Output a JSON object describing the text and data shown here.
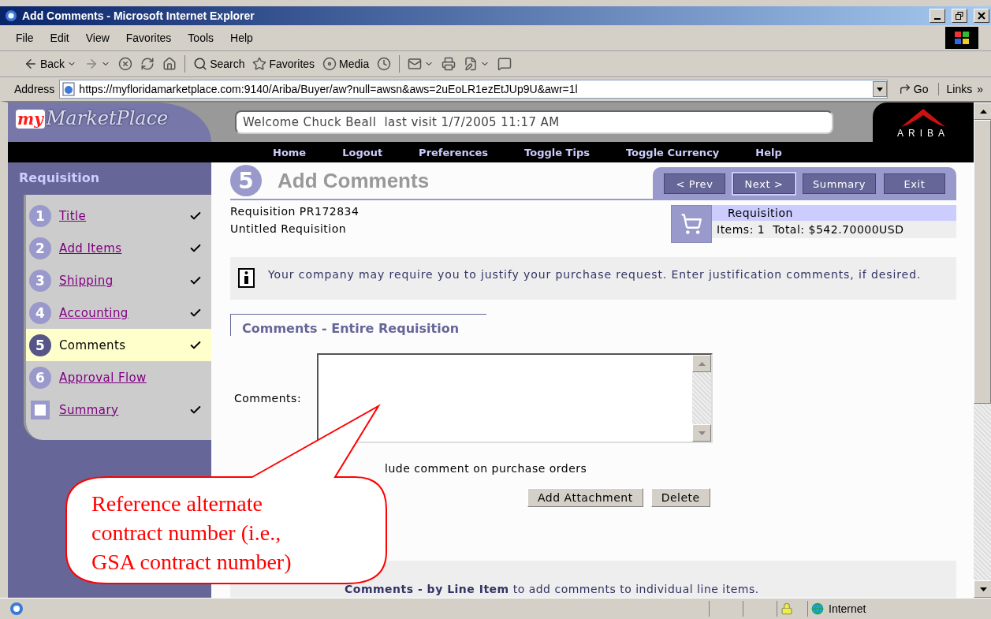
{
  "window": {
    "title": "Add Comments - Microsoft Internet Explorer"
  },
  "menu": [
    "File",
    "Edit",
    "View",
    "Favorites",
    "Tools",
    "Help"
  ],
  "toolbar": [
    {
      "items": [
        {
          "kind": "back",
          "label": "Back",
          "menu": true
        },
        {
          "kind": "forward",
          "menu": true
        },
        {
          "kind": "stop",
          "menu": false
        },
        {
          "kind": "refresh",
          "menu": false
        },
        {
          "kind": "home",
          "menu": false
        }
      ]
    },
    {
      "items": [
        {
          "kind": "search",
          "label": "Search",
          "menu": false
        },
        {
          "kind": "favorites",
          "label": "Favorites",
          "menu": false
        },
        {
          "kind": "media",
          "label": "Media",
          "menu": false
        },
        {
          "kind": "history",
          "menu": false
        }
      ]
    },
    {
      "items": [
        {
          "kind": "mail",
          "menu": true
        },
        {
          "kind": "print",
          "menu": false
        },
        {
          "kind": "edit",
          "menu": true
        },
        {
          "kind": "discuss",
          "menu": false
        }
      ]
    }
  ],
  "address": {
    "label": "Address",
    "url": "https://myfloridamarketplace.com:9140/Ariba/Buyer/aw?null=awsn&aws=2uEoLR1ezEtJUp9U&awr=1l",
    "go": "Go",
    "links": "Links",
    "links_more": "»"
  },
  "header": {
    "logo_prefix": "my",
    "logo_name": "MarketPlace",
    "welcome": "Welcome Chuck Beall  last visit 1/7/2005 11:17 AM",
    "brand": "ARIBA"
  },
  "nav": [
    "Home",
    "Logout",
    "Preferences",
    "Toggle Tips",
    "Toggle Currency",
    "Help"
  ],
  "sidebar": {
    "title": "Requisition",
    "steps": [
      {
        "kind": "number",
        "marker": "1",
        "label": "Title",
        "selected": false,
        "done": true
      },
      {
        "kind": "number",
        "marker": "2",
        "label": "Add Items",
        "selected": false,
        "done": true
      },
      {
        "kind": "number",
        "marker": "3",
        "label": "Shipping",
        "selected": false,
        "done": true
      },
      {
        "kind": "number",
        "marker": "4",
        "label": "Accounting",
        "selected": false,
        "done": true
      },
      {
        "kind": "number",
        "marker": "5",
        "label": "Comments",
        "selected": true,
        "done": true
      },
      {
        "kind": "number",
        "marker": "6",
        "label": "Approval Flow",
        "selected": false,
        "done": false
      },
      {
        "kind": "square",
        "label": "Summary",
        "selected": false,
        "done": true
      }
    ]
  },
  "page": {
    "step": "5",
    "title": "Add Comments",
    "buttons": [
      {
        "label": "< Prev",
        "selected": false
      },
      {
        "label": "Next >",
        "selected": true
      },
      {
        "label": "Summary",
        "selected": false
      },
      {
        "label": "Exit",
        "selected": false
      }
    ]
  },
  "requisition": {
    "id": "Requisition PR172834",
    "name": "Untitled Requisition"
  },
  "cart": {
    "title": "Requisition",
    "summary": "Items: 1  Total: $542.70000USD"
  },
  "info": "Your company may require you to justify your purchase request. Enter justification comments, if desired.",
  "section_title": "Comments - Entire Requisition",
  "comments": {
    "label": "Comments:"
  },
  "include_note": "lude comment on purchase orders",
  "actions": [
    "Add Attachment",
    "Delete"
  ],
  "line_item_tip": "**Comments - by Line Item** to add comments to individual line items.",
  "callout": "Reference alternate contract number (i.e., GSA contract number)",
  "status_bar": {
    "zone": "Internet"
  }
}
